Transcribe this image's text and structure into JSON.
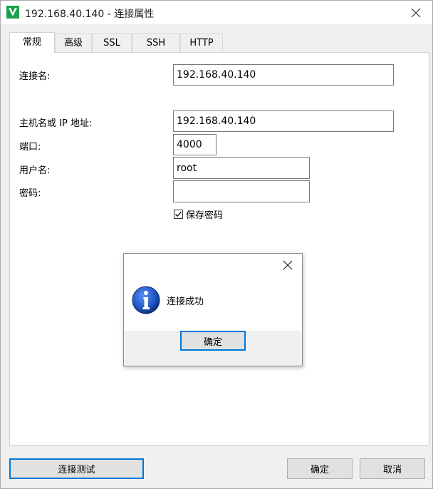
{
  "window": {
    "title": "192.168.40.140 - 连接属性",
    "icons": {
      "app": "navicat-icon",
      "close": "close-icon"
    }
  },
  "tabs": [
    {
      "label": "常规",
      "active": true
    },
    {
      "label": "高级",
      "active": false
    },
    {
      "label": "SSL",
      "active": false
    },
    {
      "label": "SSH",
      "active": false
    },
    {
      "label": "HTTP",
      "active": false
    }
  ],
  "form": {
    "connection_name": {
      "label": "连接名:",
      "value": "192.168.40.140"
    },
    "host": {
      "label": "主机名或 IP 地址:",
      "value": "192.168.40.140"
    },
    "port": {
      "label": "端口:",
      "value": "4000"
    },
    "username": {
      "label": "用户名:",
      "value": "root"
    },
    "password": {
      "label": "密码:",
      "value": ""
    },
    "save_password": {
      "label": "保存密码",
      "checked": true
    }
  },
  "buttons": {
    "test_connection": "连接测试",
    "ok": "确定",
    "cancel": "取消"
  },
  "dialog": {
    "message": "连接成功",
    "ok": "确定",
    "icon": "info-icon"
  },
  "colors": {
    "accent": "#0078d7",
    "icon_green": "#1aa04a",
    "info_blue": "#1f56c4"
  }
}
